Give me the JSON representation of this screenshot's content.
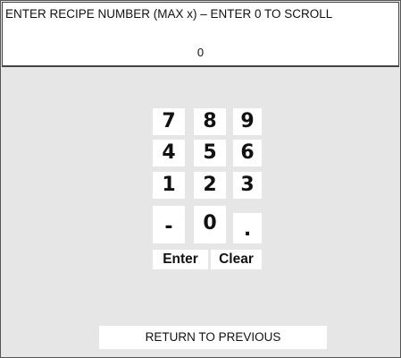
{
  "prompt": {
    "instruction": "ENTER RECIPE NUMBER (MAX x) – ENTER 0 TO SCROLL",
    "value": "0"
  },
  "keypad": {
    "keys": [
      "7",
      "8",
      "9",
      "4",
      "5",
      "6",
      "1",
      "2",
      "3",
      "-",
      "0",
      "."
    ],
    "enter_label": "Enter",
    "clear_label": "Clear"
  },
  "return_button": {
    "label": "RETURN TO PREVIOUS"
  }
}
